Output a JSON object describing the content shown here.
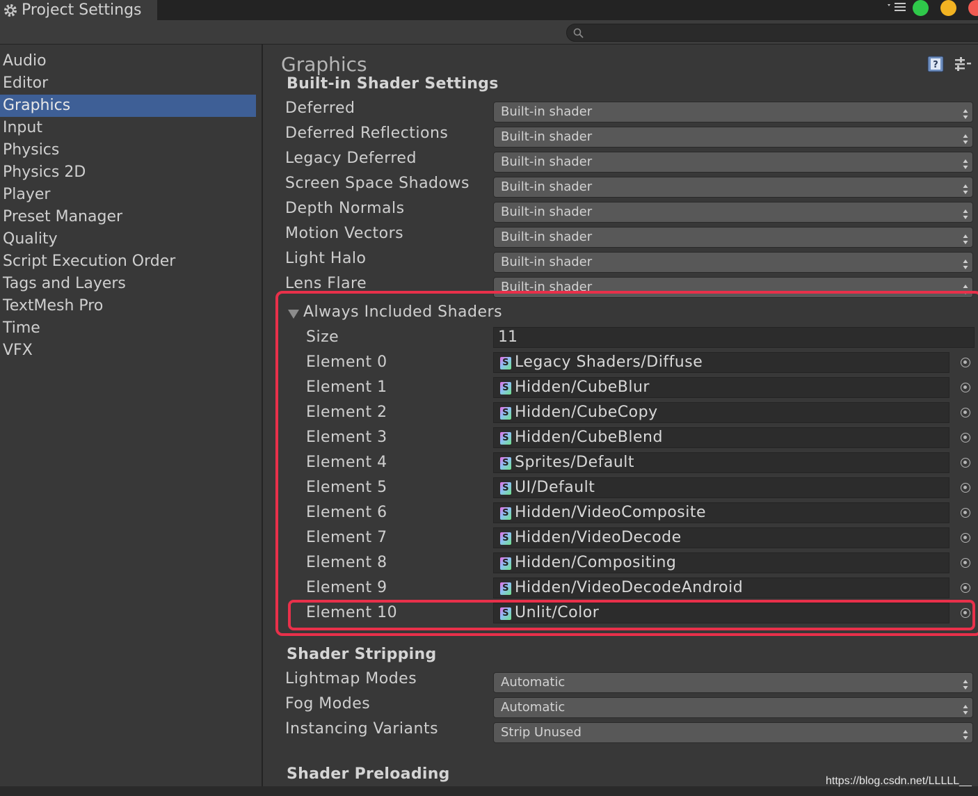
{
  "window": {
    "title": "Project Settings",
    "traffic_colors": [
      "#2fc84a",
      "#f2b322",
      "#f25b52"
    ]
  },
  "search": {
    "placeholder": ""
  },
  "sidebar": {
    "items": [
      {
        "label": "Audio"
      },
      {
        "label": "Editor"
      },
      {
        "label": "Graphics",
        "selected": true
      },
      {
        "label": "Input"
      },
      {
        "label": "Physics"
      },
      {
        "label": "Physics 2D"
      },
      {
        "label": "Player"
      },
      {
        "label": "Preset Manager"
      },
      {
        "label": "Quality"
      },
      {
        "label": "Script Execution Order"
      },
      {
        "label": "Tags and Layers"
      },
      {
        "label": "TextMesh Pro"
      },
      {
        "label": "Time"
      },
      {
        "label": "VFX"
      }
    ]
  },
  "main": {
    "title": "Graphics",
    "builtin": {
      "heading": "Built-in Shader Settings",
      "rows": [
        {
          "label": "Deferred",
          "value": "Built-in shader"
        },
        {
          "label": "Deferred Reflections",
          "value": "Built-in shader"
        },
        {
          "label": "Legacy Deferred",
          "value": "Built-in shader"
        },
        {
          "label": "Screen Space Shadows",
          "value": "Built-in shader"
        },
        {
          "label": "Depth Normals",
          "value": "Built-in shader"
        },
        {
          "label": "Motion Vectors",
          "value": "Built-in shader"
        },
        {
          "label": "Light Halo",
          "value": "Built-in shader"
        },
        {
          "label": "Lens Flare",
          "value": "Built-in shader"
        }
      ]
    },
    "always_included": {
      "heading": "Always Included Shaders",
      "size_label": "Size",
      "size_value": "11",
      "elements": [
        {
          "label": "Element 0",
          "value": "Legacy Shaders/Diffuse"
        },
        {
          "label": "Element 1",
          "value": "Hidden/CubeBlur"
        },
        {
          "label": "Element 2",
          "value": "Hidden/CubeCopy"
        },
        {
          "label": "Element 3",
          "value": "Hidden/CubeBlend"
        },
        {
          "label": "Element 4",
          "value": "Sprites/Default"
        },
        {
          "label": "Element 5",
          "value": "UI/Default"
        },
        {
          "label": "Element 6",
          "value": "Hidden/VideoComposite"
        },
        {
          "label": "Element 7",
          "value": "Hidden/VideoDecode"
        },
        {
          "label": "Element 8",
          "value": "Hidden/Compositing"
        },
        {
          "label": "Element 9",
          "value": "Hidden/VideoDecodeAndroid"
        },
        {
          "label": "Element 10",
          "value": "Unlit/Color"
        }
      ],
      "shader_icon_letter": "S"
    },
    "stripping": {
      "heading": "Shader Stripping",
      "rows": [
        {
          "label": "Lightmap Modes",
          "value": "Automatic"
        },
        {
          "label": "Fog Modes",
          "value": "Automatic"
        },
        {
          "label": "Instancing Variants",
          "value": "Strip Unused"
        }
      ]
    },
    "preloading": {
      "heading": "Shader Preloading"
    }
  },
  "highlight_color": "#e8304a",
  "watermark": "https://blog.csdn.net/LLLLL__"
}
